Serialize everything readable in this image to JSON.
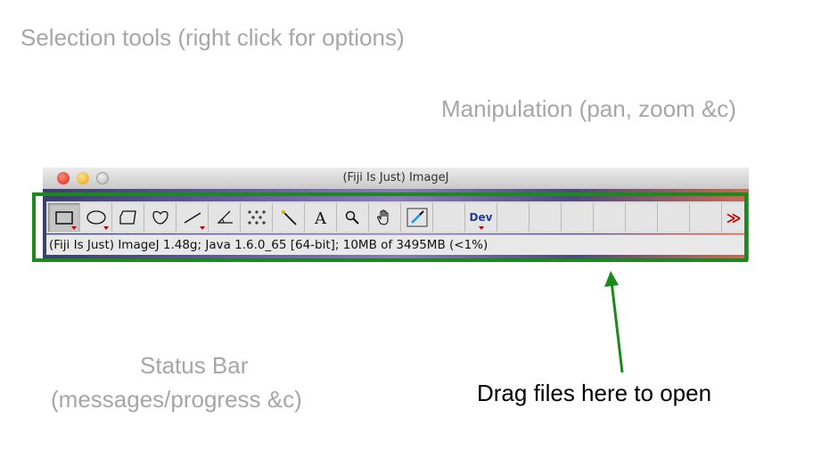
{
  "annotations": {
    "selection_tools": "Selection tools (right click for options)",
    "manipulation": "Manipulation (pan, zoom &c)",
    "status_bar_line1": "Status Bar",
    "status_bar_line2": "(messages/progress &c)",
    "drag_files": "Drag files here to open"
  },
  "window": {
    "title": "(Fiji Is Just) ImageJ"
  },
  "toolbar": {
    "tools": [
      {
        "id": "rectangle",
        "icon": "rectangle-selection-icon",
        "selected": true,
        "has_options": true
      },
      {
        "id": "oval",
        "icon": "oval-selection-icon",
        "selected": false,
        "has_options": true
      },
      {
        "id": "polygon",
        "icon": "polygon-selection-icon",
        "selected": false,
        "has_options": false
      },
      {
        "id": "freehand",
        "icon": "freehand-selection-icon",
        "selected": false,
        "has_options": false
      },
      {
        "id": "line",
        "icon": "line-selection-icon",
        "selected": false,
        "has_options": true
      },
      {
        "id": "angle",
        "icon": "angle-tool-icon",
        "selected": false,
        "has_options": false
      },
      {
        "id": "point",
        "icon": "multipoint-tool-icon",
        "selected": false,
        "has_options": false
      },
      {
        "id": "wand",
        "icon": "wand-tool-icon",
        "selected": false,
        "has_options": false
      },
      {
        "id": "text",
        "icon": "text-tool-icon",
        "selected": false,
        "has_options": false
      },
      {
        "id": "zoom",
        "icon": "magnifier-icon",
        "selected": false,
        "has_options": false
      },
      {
        "id": "hand",
        "icon": "hand-scroll-icon",
        "selected": false,
        "has_options": false
      },
      {
        "id": "dropper",
        "icon": "color-picker-icon",
        "selected": false,
        "has_options": false
      }
    ],
    "dev_label": "Dev",
    "more_label": "≫"
  },
  "status": {
    "text": "(Fiji Is Just) ImageJ 1.48g; Java 1.6.0_65 [64-bit]; 10MB of 3495MB (<1%)"
  },
  "colors": {
    "highlight_frame": "#1a8a1a",
    "annotation_grey": "#a6a6a6",
    "arrow": "#1a8a1a"
  }
}
